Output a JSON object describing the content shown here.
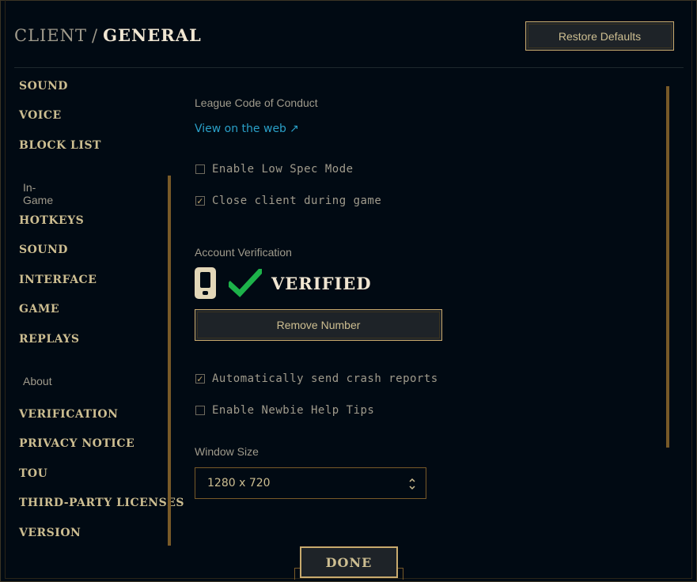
{
  "header": {
    "breadcrumb_parent": "CLIENT",
    "breadcrumb_sep": "/",
    "breadcrumb_current": "GENERAL",
    "restore_defaults_label": "Restore Defaults"
  },
  "sidebar": {
    "client_items": [
      "SOUND",
      "VOICE",
      "BLOCK LIST"
    ],
    "in_game_section": "In-Game",
    "in_game_items": [
      "HOTKEYS",
      "SOUND",
      "INTERFACE",
      "GAME",
      "REPLAYS"
    ],
    "about_section": "About",
    "about_items": [
      "VERIFICATION",
      "PRIVACY NOTICE",
      "TOU",
      "THIRD-PARTY LICENSES",
      "VERSION"
    ]
  },
  "main": {
    "conduct_label": "League Code of Conduct",
    "view_web_label": "View on the web",
    "link_arrow": "↗",
    "low_spec": {
      "label": "Enable Low Spec Mode",
      "checked": false
    },
    "close_client": {
      "label": "Close client during game",
      "checked": true
    },
    "account_verification_label": "Account Verification",
    "verified_text": "VERIFIED",
    "remove_number_label": "Remove Number",
    "crash_reports": {
      "label": "Automatically send crash reports",
      "checked": true
    },
    "newbie_tips": {
      "label": "Enable Newbie Help Tips",
      "checked": false
    },
    "window_size_label": "Window Size",
    "window_size_value": "1280 x 720"
  },
  "footer": {
    "done_label": "DONE"
  },
  "colors": {
    "background": "#010a13",
    "gold": "#c8aa6e",
    "gold_text": "#cdbe91",
    "link": "#2aa0c8",
    "verified_check": "#1db24a",
    "phone_icon": "#e3d7b8"
  },
  "icons": {
    "phone": "phone-icon",
    "check": "checkmark-icon",
    "external_link": "external-link-icon",
    "select_chevrons": "up-down-chevron-icon"
  }
}
